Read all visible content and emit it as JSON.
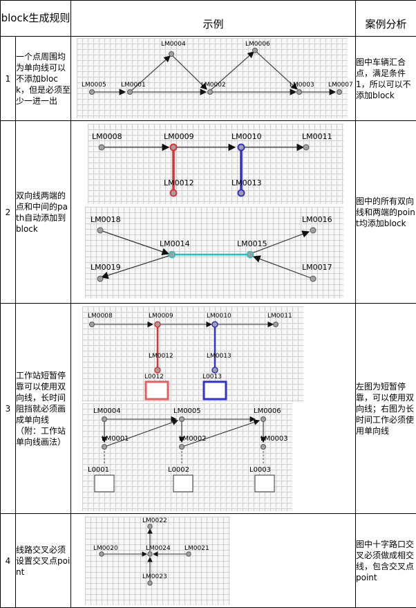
{
  "header": {
    "col1": "block生成规则",
    "col2": "示例",
    "col3": "案例分析"
  },
  "rows": [
    {
      "num": "1",
      "rule": "一个点周围均为单向线可以不添加block，但是必须至少一进一出",
      "analysis": "图中车辆汇合点，满足条件1，所以可以不添加block",
      "labels": [
        "LM0004",
        "LM0006",
        "LM0005",
        "LM0001",
        "LM0002",
        "LM0003",
        "LM0007"
      ]
    },
    {
      "num": "2",
      "rule": "双向线两端的点和中间的path自动添加到block",
      "analysis": "图中的所有双向线和两端的point均添加block",
      "labels_top": [
        "LM0008",
        "LM0009",
        "LM0010",
        "LM0011",
        "LM0012",
        "LM0013"
      ],
      "labels_bottom": [
        "LM0018",
        "LM0016",
        "LM0014",
        "LM0015",
        "LM0019",
        "LM0017"
      ]
    },
    {
      "num": "3",
      "rule": "工作站短暂停靠可以使用双向线，长时间阻挡就必须画成单向线（附：工作站单向线画法）",
      "analysis": "左图为短暂停靠，可以使用双向线；右图为长时间工作必须使用单向线",
      "labels_top": [
        "LM0008",
        "LM0009",
        "LM0010",
        "LM0011",
        "LM0012",
        "LM0013",
        "L0012",
        "L0013"
      ],
      "labels_bottom": [
        "LM0004",
        "LM0005",
        "LM0006",
        "LM0001",
        "LM0002",
        "LM0003",
        "L0001",
        "L0002",
        "L0003"
      ]
    },
    {
      "num": "4",
      "rule": "线路交叉必须设置交叉点point",
      "analysis": "图中十字路口交叉必须做成相交线，包含交叉点point",
      "labels": [
        "LM0022",
        "LM0020",
        "LM0024",
        "LM0021",
        "LM0023"
      ]
    }
  ],
  "colors": {
    "red": "#e03030",
    "blue": "#3030d0",
    "cyan": "#20c0c0",
    "node": "#a0a0a0"
  }
}
